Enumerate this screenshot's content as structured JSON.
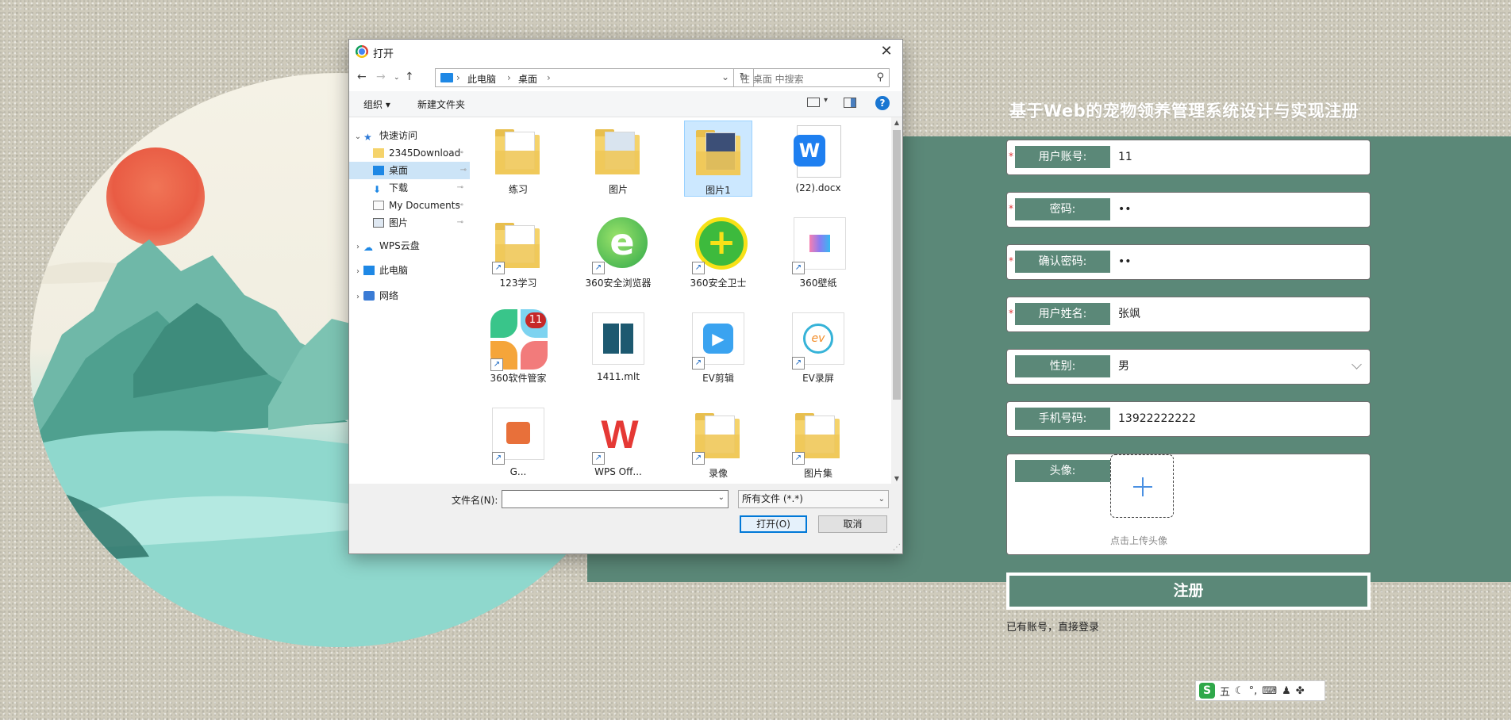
{
  "page": {
    "register_title": "基于Web的宠物领养管理系统设计与实现注册",
    "fields": [
      {
        "label": "用户账号:",
        "value": "11",
        "required": true
      },
      {
        "label": "密码:",
        "value": "••",
        "required": true
      },
      {
        "label": "确认密码:",
        "value": "••",
        "required": true
      },
      {
        "label": "用户姓名:",
        "value": "张飒",
        "required": true
      },
      {
        "label": "性别:",
        "value": "男",
        "required": false
      },
      {
        "label": "手机号码:",
        "value": "13922222222",
        "required": false
      }
    ],
    "required_mark": "*",
    "avatar_label": "头像:",
    "avatar_hint": "点击上传头像",
    "register_button": "注册",
    "login_link": "已有账号，直接登录",
    "ime_label": "五",
    "ime_logo": "S"
  },
  "dialog": {
    "title": "打开",
    "close": "✕",
    "breadcrumb": [
      "此电脑",
      "桌面"
    ],
    "search_placeholder": "在 桌面 中搜索",
    "toolbar": {
      "organize": "组织 ▾",
      "new_folder": "新建文件夹",
      "help": "?"
    },
    "tree": [
      {
        "label": "快速访问",
        "expand": "⌄",
        "pin": ""
      },
      {
        "label": "2345Download",
        "expand": "",
        "pin": "📌"
      },
      {
        "label": "桌面",
        "expand": "",
        "pin": "📌",
        "selected": true
      },
      {
        "label": "下载",
        "expand": "",
        "pin": "📌"
      },
      {
        "label": "My Documents",
        "expand": "",
        "pin": "📌"
      },
      {
        "label": "图片",
        "expand": "",
        "pin": "📌"
      },
      {
        "label": "WPS云盘",
        "expand": "›",
        "pin": ""
      },
      {
        "label": "此电脑",
        "expand": "›",
        "pin": ""
      },
      {
        "label": "网络",
        "expand": "›",
        "pin": ""
      }
    ],
    "files": [
      {
        "name": "练习",
        "kind": "folder"
      },
      {
        "name": "图片",
        "kind": "folder"
      },
      {
        "name": "图片1",
        "kind": "folder",
        "selected": true
      },
      {
        "name": "(22).docx",
        "kind": "wps-doc"
      },
      {
        "name": "123学习",
        "kind": "folder-shortcut"
      },
      {
        "name": "360安全浏览器",
        "kind": "browser"
      },
      {
        "name": "360安全卫士",
        "kind": "guard"
      },
      {
        "name": "360壁纸",
        "kind": "wallpaper"
      },
      {
        "name": "360软件管家",
        "kind": "softmgr",
        "badge": "11"
      },
      {
        "name": "1411.mlt",
        "kind": "mlt"
      },
      {
        "name": "EV剪辑",
        "kind": "ev-edit"
      },
      {
        "name": "EV录屏",
        "kind": "ev-rec"
      },
      {
        "name": "G...",
        "kind": "ppt"
      },
      {
        "name": "WPS Off...",
        "kind": "wps"
      },
      {
        "name": "录像",
        "kind": "folder-shortcut"
      },
      {
        "name": "图片集",
        "kind": "folder-shortcut"
      }
    ],
    "filename_label": "文件名(N):",
    "filename_value": "",
    "filetype": "所有文件 (*.*)",
    "open_button": "打开(O)",
    "cancel_button": "取消"
  },
  "colors": {
    "accent": "#5b8878",
    "dialog_select": "#cce8ff",
    "primary_blue": "#0078d7"
  }
}
